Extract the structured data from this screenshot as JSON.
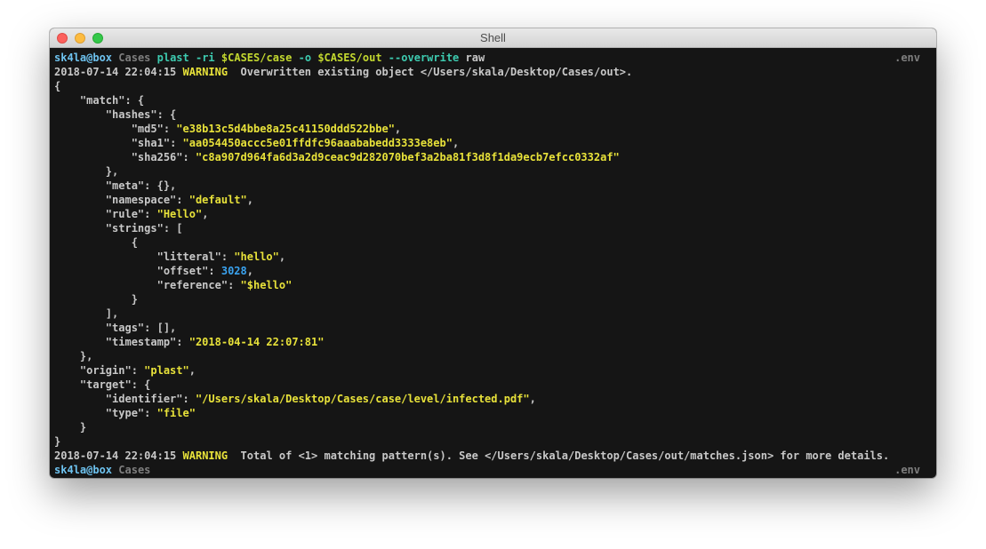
{
  "window": {
    "title": "Shell"
  },
  "prompt": {
    "user": "sk4la@box",
    "dir": "Cases",
    "env": ".env"
  },
  "command": {
    "program": "plast",
    "flag_input": "-ri",
    "input_path": "$CASES/case",
    "flag_output": "-o",
    "output_path": "$CASES/out",
    "flag_overwrite": "--overwrite",
    "format": "raw"
  },
  "log1": {
    "timestamp": "2018-07-14 22:04:15",
    "level": "WARNING",
    "message": "Overwritten existing object </Users/skala/Desktop/Cases/out>."
  },
  "json": {
    "match_key": "\"match\"",
    "hashes_key": "\"hashes\"",
    "md5_key": "\"md5\"",
    "md5": "\"e38b13c5d4bbe8a25c41150ddd522bbe\"",
    "sha1_key": "\"sha1\"",
    "sha1": "\"aa054450accc5e01ffdfc96aaababedd3333e8eb\"",
    "sha256_key": "\"sha256\"",
    "sha256": "\"c8a907d964fa6d3a2d9ceac9d282070bef3a2ba81f3d8f1da9ecb7efcc0332af\"",
    "meta_key": "\"meta\"",
    "namespace_key": "\"namespace\"",
    "namespace": "\"default\"",
    "rule_key": "\"rule\"",
    "rule": "\"Hello\"",
    "strings_key": "\"strings\"",
    "litteral_key": "\"litteral\"",
    "litteral": "\"hello\"",
    "offset_key": "\"offset\"",
    "offset": "3028",
    "reference_key": "\"reference\"",
    "reference": "\"$hello\"",
    "tags_key": "\"tags\"",
    "timestamp_key": "\"timestamp\"",
    "timestamp": "\"2018-04-14 22:07:81\"",
    "origin_key": "\"origin\"",
    "origin": "\"plast\"",
    "target_key": "\"target\"",
    "identifier_key": "\"identifier\"",
    "identifier": "\"/Users/skala/Desktop/Cases/case/level/infected.pdf\"",
    "type_key": "\"type\"",
    "type": "\"file\""
  },
  "log2": {
    "timestamp": "2018-07-14 22:04:15",
    "level": "WARNING",
    "message": "Total of <1> matching pattern(s). See </Users/skala/Desktop/Cases/out/matches.json> for more details."
  },
  "colors": {
    "terminal_bg": "#151515",
    "text": "#c8c8c8",
    "user": "#6ec3f0",
    "command": "#3dcbb0",
    "variable": "#c3d82f",
    "string": "#e8e23a",
    "number": "#3aa3f0",
    "dim": "#7e7e7e"
  }
}
